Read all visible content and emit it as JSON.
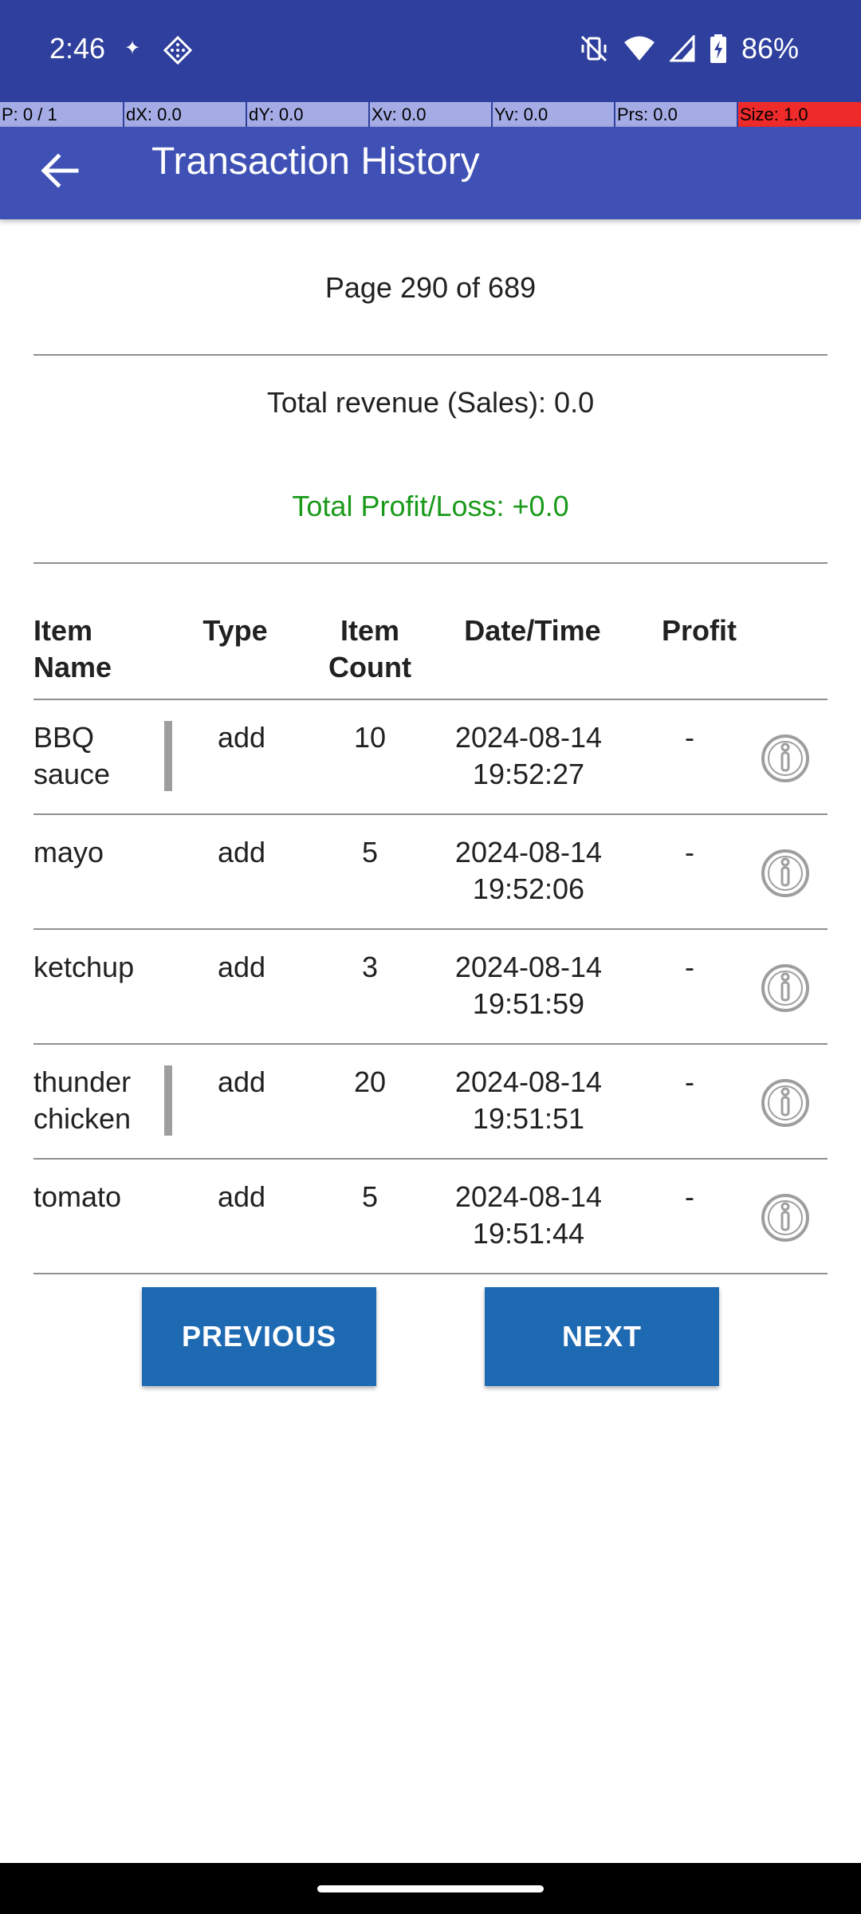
{
  "status_bar": {
    "time": "2:46",
    "battery": "86%",
    "icons": [
      "sparkle-icon",
      "app-notification-icon",
      "vibrate-off-icon",
      "wifi-icon",
      "cell-signal-icon",
      "battery-charging-icon"
    ]
  },
  "pointer_overlay": {
    "p": "P: 0 / 1",
    "dx": "dX: 0.0",
    "dy": "dY: 0.0",
    "xv": "Xv: 0.0",
    "yv": "Yv: 0.0",
    "prs": "Prs: 0.0",
    "size": "Size: 1.0"
  },
  "app_bar": {
    "title": "Transaction History",
    "back_icon": "arrow-back-icon",
    "color": "#3f51b5"
  },
  "summary": {
    "page_info": "Page 290 of 689",
    "revenue": "Total revenue (Sales): 0.0",
    "profit_loss": "Total Profit/Loss: +0.0",
    "profit_color": "#1a9a1a"
  },
  "table": {
    "headers": {
      "item_name": "Item\nName",
      "type": "Type",
      "item_count": "Item\nCount",
      "date_time": "Date/Time",
      "profit": "Profit"
    },
    "rows": [
      {
        "name": "BBQ\nsauce",
        "type": "add",
        "count": "10",
        "date": "2024-08-14\n19:52:27",
        "profit": "-"
      },
      {
        "name": "mayo",
        "type": "add",
        "count": "5",
        "date": "2024-08-14\n19:52:06",
        "profit": "-"
      },
      {
        "name": "ketchup",
        "type": "add",
        "count": "3",
        "date": "2024-08-14\n19:51:59",
        "profit": "-"
      },
      {
        "name": "thunder\nchicken",
        "type": "add",
        "count": "20",
        "date": "2024-08-14\n19:51:51",
        "profit": "-"
      },
      {
        "name": "tomato",
        "type": "add",
        "count": "5",
        "date": "2024-08-14\n19:51:44",
        "profit": "-"
      }
    ]
  },
  "pagination": {
    "previous": "PREVIOUS",
    "next": "NEXT",
    "color": "#1e6ab2"
  }
}
